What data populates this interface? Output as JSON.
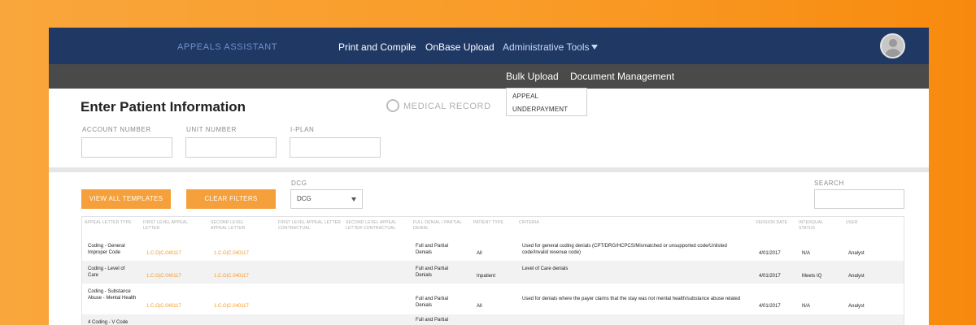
{
  "header": {
    "brand": "APPEALS ASSISTANT",
    "nav": [
      "Print and Compile",
      "OnBase Upload",
      "Administrative Tools"
    ]
  },
  "subnav": [
    "Bulk Upload",
    "Document Management"
  ],
  "dropdown": [
    "APPEAL",
    "UNDERPAYMENT"
  ],
  "form": {
    "title": "Enter Patient Information",
    "radio_label": "MEDICAL RECORD",
    "fields": [
      "ACCOUNT NUMBER",
      "UNIT NUMBER",
      "I-PLAN"
    ]
  },
  "filters": {
    "view_all": "VIEW ALL TEMPLATES",
    "clear": "CLEAR FILTERS",
    "dcg_label": "DCG",
    "dcg_value": "DCG",
    "search_label": "SEARCH"
  },
  "table": {
    "headers": [
      "APPEAL LETTER TYPE",
      "FIRST LEVEL APPEAL LETTER",
      "SECOND LEVEL APPEAL LETTER",
      "FIRST LEVEL APPEAL LETTER CONTRACTUAL",
      "SECOND LEVEL APPEAL LETTER CONTRACTUAL",
      "FULL DENIAL / PARTIAL DENIAL",
      "PATIENT TYPE",
      "CRITERIA",
      "VERSION DATE",
      "INTERQUAL STATUS",
      "USER"
    ],
    "rows": [
      {
        "type": "Coding - General Improper Code",
        "first": "1.C.G|C.040117",
        "second": "1.C.G|C.040117",
        "denial": "Full and Partial Denials",
        "patient": "All",
        "criteria": "Used for general coding denials (CPT/DRG/HCPCS/Mismatched or unsupported code/Unlisted code/Invalid revenue code)",
        "date": "4/01/2017",
        "status": "N/A",
        "user": "Analyst"
      },
      {
        "type": "Coding - Level of Care",
        "first": "1.C.G|C.040117",
        "second": "1.C.G|C.040117",
        "denial": "Full and Partial Denials",
        "patient": "Inpatient",
        "criteria": "Level of Care denials",
        "date": "4/01/2017",
        "status": "Meets IQ",
        "user": "Analyst"
      },
      {
        "type": "Coding - Substance Abuse - Mental Health",
        "first": "1.C.G|C.040117",
        "second": "1.C.G|C.040117",
        "denial": "Full and Partial Denials",
        "patient": "All",
        "criteria": "Used for denials where the payer claims that the stay was not mental health/substance abuse related",
        "date": "4/01/2017",
        "status": "N/A",
        "user": "Analyst"
      },
      {
        "type": "4 Coding - V Code",
        "first": "",
        "second": "",
        "denial": "Full and Partial",
        "patient": "",
        "criteria": "",
        "date": "",
        "status": "",
        "user": ""
      }
    ]
  }
}
